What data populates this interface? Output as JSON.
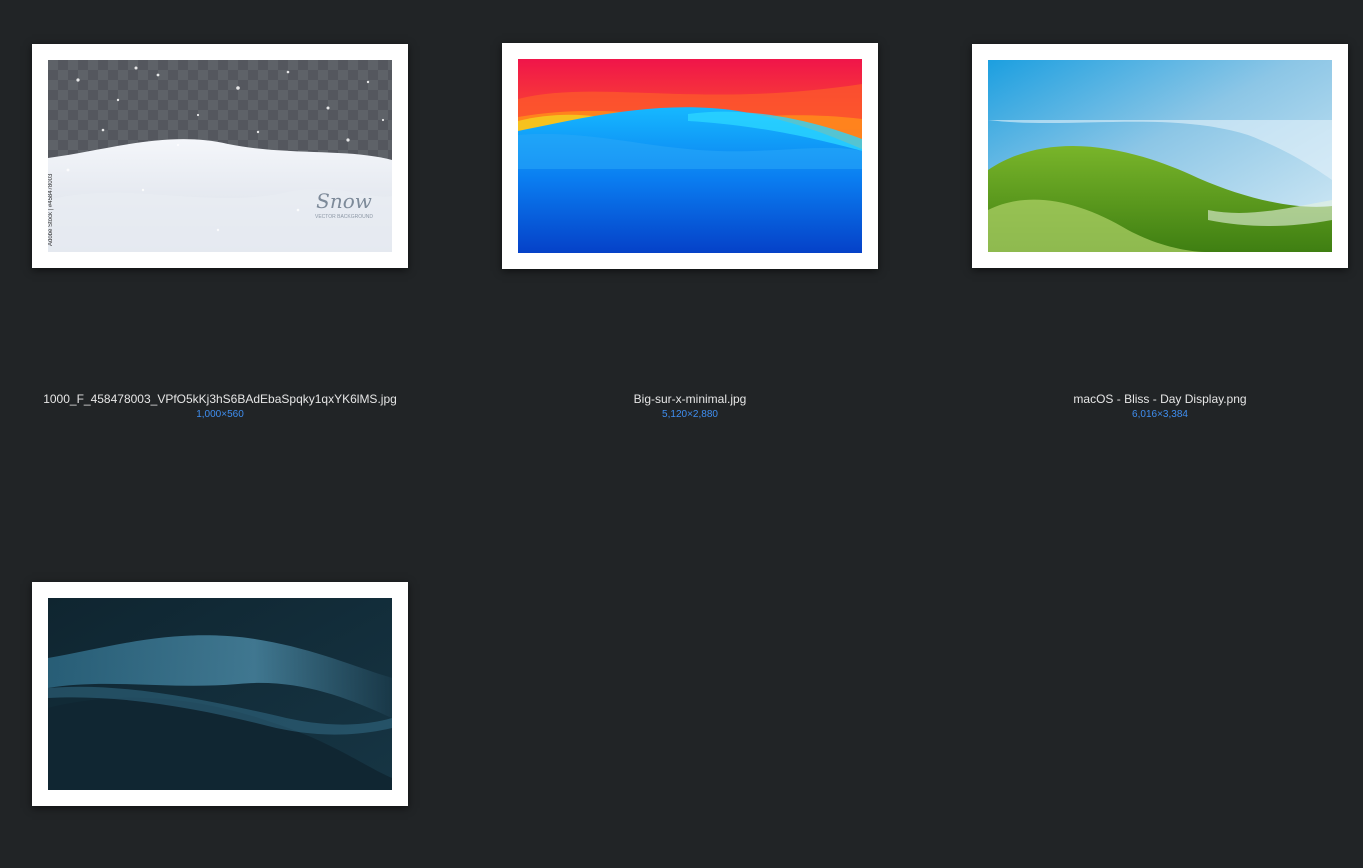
{
  "files": [
    {
      "name": "1000_F_458478003_VPfO5kKj3hS6BAdEbaSpqky1qxYK6lMS.jpg",
      "dimensions": "1,000×560",
      "watermark_side": "Adobe Stock | #458478003",
      "logo_title": "Snow",
      "logo_subtitle": "VECTOR BACKGROUND"
    },
    {
      "name": "Big-sur-x-minimal.jpg",
      "dimensions": "5,120×2,880"
    },
    {
      "name": "macOS - Bliss - Day Display.png",
      "dimensions": "6,016×3,384"
    },
    {
      "name": "",
      "dimensions": ""
    }
  ],
  "colors": {
    "background": "#212426",
    "filename_text": "#e6e6e6",
    "dimensions_text": "#3f8ef0"
  }
}
